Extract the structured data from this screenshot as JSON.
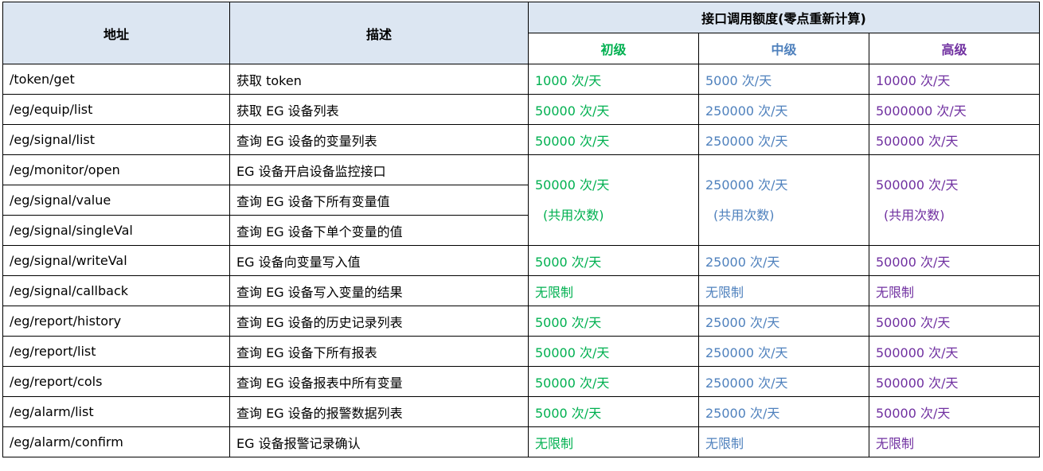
{
  "header": {
    "address": "地址",
    "description": "描述",
    "quota": "接口调用额度(零点重新计算)",
    "levels": [
      "初级",
      "中级",
      "高级"
    ]
  },
  "rows": [
    {
      "address": "/token/get",
      "desc": "获取 token",
      "q": [
        "1000 次/天",
        "5000 次/天",
        "10000 次/天"
      ]
    },
    {
      "address": "/eg/equip/list",
      "desc": "获取 EG 设备列表",
      "q": [
        "50000 次/天",
        "250000 次/天",
        "5000000 次/天"
      ]
    },
    {
      "address": "/eg/signal/list",
      "desc": "查询 EG 设备的变量列表",
      "q": [
        "50000 次/天",
        "250000 次/天",
        "500000 次/天"
      ]
    },
    {
      "address": "/eg/monitor/open",
      "desc": "EG 设备开启设备监控接口"
    },
    {
      "address": "/eg/signal/value",
      "desc": "查询 EG 设备下所有变量值"
    },
    {
      "address": "/eg/signal/singleVal",
      "desc": "查询 EG 设备下单个变量的值"
    },
    {
      "address": "/eg/signal/writeVal",
      "desc": "EG 设备向变量写入值",
      "q": [
        "5000 次/天",
        "25000 次/天",
        "50000 次/天"
      ]
    },
    {
      "address": "/eg/signal/callback",
      "desc": "查询 EG 设备写入变量的结果",
      "q": [
        "无限制",
        "无限制",
        "无限制"
      ]
    },
    {
      "address": "/eg/report/history",
      "desc": "查询 EG 设备的历史记录列表",
      "q": [
        "5000 次/天",
        "25000 次/天",
        "50000 次/天"
      ]
    },
    {
      "address": "/eg/report/list",
      "desc": "查询 EG 设备下所有报表",
      "q": [
        "50000 次/天",
        "250000 次/天",
        "500000 次/天"
      ]
    },
    {
      "address": "/eg/report/cols",
      "desc": "查询 EG 设备报表中所有变量",
      "q": [
        "50000 次/天",
        "250000 次/天",
        "500000 次/天"
      ]
    },
    {
      "address": "/eg/alarm/list",
      "desc": "查询 EG 设备的报警数据列表",
      "q": [
        "5000 次/天",
        "25000 次/天",
        "50000 次/天"
      ]
    },
    {
      "address": "/eg/alarm/confirm",
      "desc": "EG 设备报警记录确认",
      "q": [
        "无限制",
        "无限制",
        "无限制"
      ]
    }
  ],
  "shared": {
    "q": [
      "50000 次/天",
      "250000 次/天",
      "500000 次/天"
    ],
    "note": "(共用次数)"
  },
  "colors": {
    "level1": "#00b050",
    "level2": "#4f81bd",
    "level3": "#7030a0",
    "header_bg": "#dce6f2"
  }
}
